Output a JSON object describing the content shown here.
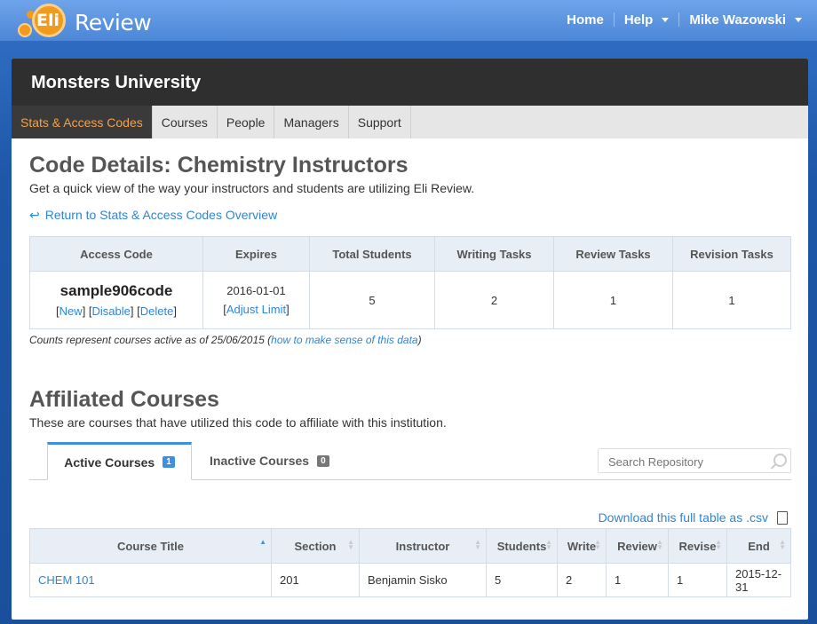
{
  "app": {
    "logo_eli": "Eli",
    "logo_review": "Review"
  },
  "topnav": {
    "home": "Home",
    "help": "Help",
    "user": "Mike Wazowski"
  },
  "panel": {
    "title": "Monsters University"
  },
  "subnav": [
    "Stats & Access Codes",
    "Courses",
    "People",
    "Managers",
    "Support"
  ],
  "page": {
    "title": "Code Details: Chemistry Instructors",
    "subtitle": "Get a quick view of the way your instructors and students are utilizing Eli Review.",
    "back_link": "Return to Stats & Access Codes Overview"
  },
  "stats_table": {
    "headers": [
      "Access Code",
      "Expires",
      "Total Students",
      "Writing Tasks",
      "Review Tasks",
      "Revision Tasks"
    ],
    "code": "sample906code",
    "actions": {
      "new": "New",
      "disable": "Disable",
      "delete": "Delete"
    },
    "expires": "2016-01-01",
    "adjust": "Adjust Limit",
    "total_students": "5",
    "writing_tasks": "2",
    "review_tasks": "1",
    "revision_tasks": "1"
  },
  "note": {
    "text": "Counts represent courses active as of 25/06/2015 (",
    "link": "how to make sense of this data",
    "close": ")"
  },
  "affiliated": {
    "title": "Affiliated Courses",
    "subtitle": "These are courses that have utilized this code to affiliate with this institution.",
    "tabs": [
      {
        "label": "Active Courses",
        "count": "1"
      },
      {
        "label": "Inactive Courses",
        "count": "0"
      }
    ],
    "search_placeholder": "Search Repository",
    "download": "Download this full table as .csv"
  },
  "courses_table": {
    "headers": [
      "Course Title",
      "Section",
      "Instructor",
      "Students",
      "Write",
      "Review",
      "Revise",
      "End"
    ],
    "rows": [
      [
        "CHEM 101",
        "201",
        "Benjamin Sisko",
        "5",
        "2",
        "1",
        "1",
        "2015-12-31"
      ]
    ]
  },
  "colors": {
    "accent": "#2f86d6",
    "active_tab": "#f3a04a",
    "header_bg": "#2f2f2f"
  }
}
